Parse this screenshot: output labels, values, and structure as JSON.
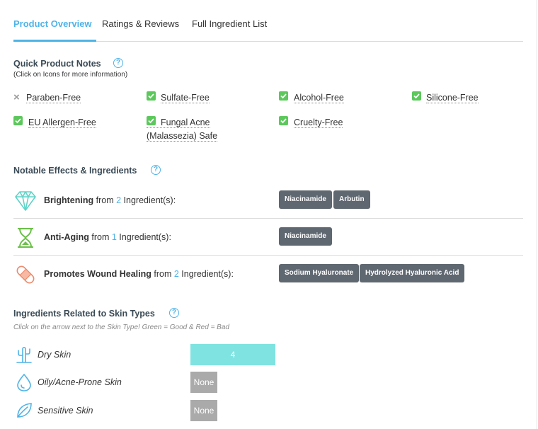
{
  "tabs": [
    "Product Overview",
    "Ratings & Reviews",
    "Full Ingredient List"
  ],
  "quick_notes": {
    "title": "Quick Product Notes",
    "help": "?",
    "subtitle": "(Click on Icons for more information)",
    "items": [
      {
        "label": "Paraben-Free",
        "status": "no"
      },
      {
        "label": "Sulfate-Free",
        "status": "yes"
      },
      {
        "label": "Alcohol-Free",
        "status": "yes"
      },
      {
        "label": "Silicone-Free",
        "status": "yes"
      },
      {
        "label": "EU Allergen-Free",
        "status": "yes"
      },
      {
        "label": "Fungal Acne",
        "label2": "(Malassezia) Safe",
        "status": "yes"
      },
      {
        "label": "Cruelty-Free",
        "status": "yes"
      }
    ]
  },
  "effects": {
    "title": "Notable Effects & Ingredients",
    "help": "?",
    "from_word": "from",
    "suffix": "Ingredient(s):",
    "rows": [
      {
        "name": "Brightening",
        "count": "2",
        "icon": "diamond-icon",
        "tags": [
          "Niacinamide",
          "Arbutin"
        ]
      },
      {
        "name": "Anti-Aging",
        "count": "1",
        "icon": "hourglass-icon",
        "tags": [
          "Niacinamide"
        ]
      },
      {
        "name": "Promotes Wound Healing",
        "count": "2",
        "icon": "bandage-icon",
        "tags": [
          "Sodium Hyaluronate",
          "Hydrolyzed Hyaluronic Acid"
        ]
      }
    ]
  },
  "skin_types": {
    "title": "Ingredients Related to Skin Types",
    "help": "?",
    "subtitle": "Click on the arrow next to the Skin Type! Green = Good & Red = Bad",
    "rows": [
      {
        "label": "Dry Skin",
        "value": "4",
        "icon": "cactus-icon"
      },
      {
        "label": "Oily/Acne-Prone Skin",
        "value": "None",
        "icon": "droplet-icon"
      },
      {
        "label": "Sensitive Skin",
        "value": "None",
        "icon": "leaf-icon"
      }
    ]
  },
  "colors": {
    "accent": "#4fb3e8",
    "check": "#5cc85c",
    "tag": "#5f6770",
    "good": "#7fe3e1",
    "none": "#aaaaaa",
    "effect_icon_teal": "#5fd3c8",
    "effect_icon_green": "#6cc04a",
    "effect_icon_orange": "#f08a6a"
  }
}
